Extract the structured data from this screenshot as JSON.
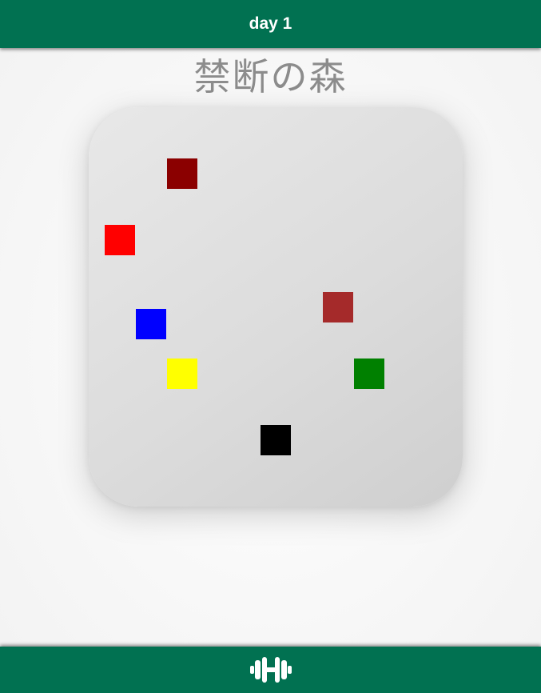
{
  "header": {
    "title": "day 1"
  },
  "level": {
    "title": "禁断の森"
  },
  "board": {
    "pieces": [
      {
        "color": "#8b0000",
        "name": "dark-red"
      },
      {
        "color": "#ff0000",
        "name": "red"
      },
      {
        "color": "#a52a2a",
        "name": "brown"
      },
      {
        "color": "#0000ff",
        "name": "blue"
      },
      {
        "color": "#ffff00",
        "name": "yellow"
      },
      {
        "color": "#008000",
        "name": "green"
      },
      {
        "color": "#000000",
        "name": "black"
      }
    ]
  },
  "footer": {
    "icon": "dumbbell-icon"
  },
  "colors": {
    "bar": "#017151",
    "title_text": "#8c8c8c"
  }
}
